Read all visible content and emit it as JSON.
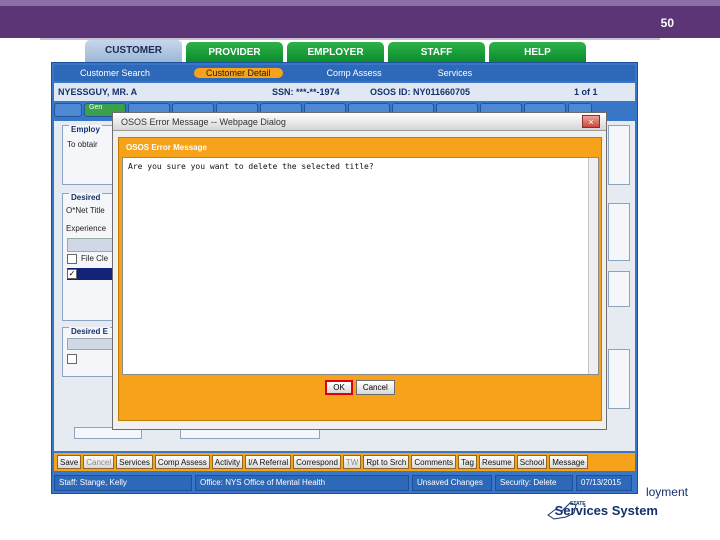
{
  "slide_number": "50",
  "top_tabs": [
    {
      "label": "CUSTOMER",
      "active": true
    },
    {
      "label": "PROVIDER",
      "active": false
    },
    {
      "label": "EMPLOYER",
      "active": false
    },
    {
      "label": "STAFF",
      "active": false
    },
    {
      "label": "HELP",
      "active": false
    }
  ],
  "subnav": [
    "Customer Search",
    "Customer Detail",
    "Comp Assess",
    "Services"
  ],
  "customer": {
    "name": "NYESSGUY, MR. A",
    "ssn": "SSN: ***-**-1974",
    "osos_id": "OSOS ID: NY011660705",
    "pagination": "1 of 1"
  },
  "left_fragments": {
    "employment_title": "Employ",
    "employment_text": "To obtair",
    "desired_title": "Desired",
    "onet_label": "O*Net Title",
    "experience_label": "Experience",
    "file_clerk": "File Cle",
    "desired_e": "Desired E",
    "gen_tab": "Gen"
  },
  "dialog": {
    "title": "OSOS Error Message -- Webpage Dialog",
    "close_glyph": "×",
    "header": "OSOS Error Message",
    "message": "Are you sure you want to delete the selected title?",
    "ok_label": "OK",
    "cancel_label": "Cancel"
  },
  "bottom_buttons": [
    {
      "label": "Save",
      "dim": false
    },
    {
      "label": "Cancel",
      "dim": true
    },
    {
      "label": "Services",
      "dim": false
    },
    {
      "label": "Comp Assess",
      "dim": false
    },
    {
      "label": "Activity",
      "dim": false
    },
    {
      "label": "I/A Referral",
      "dim": false
    },
    {
      "label": "Correspond",
      "dim": false
    },
    {
      "label": "TW",
      "dim": true
    },
    {
      "label": "Rpt to Srch",
      "dim": false
    },
    {
      "label": "Comments",
      "dim": false
    },
    {
      "label": "Tag",
      "dim": false
    },
    {
      "label": "Resume",
      "dim": false
    },
    {
      "label": "School",
      "dim": false
    },
    {
      "label": "Message",
      "dim": false
    }
  ],
  "status": {
    "staff": "Staff: Stange, Kelly",
    "office": "Office: NYS Office of Mental Health",
    "unsaved": "Unsaved Changes",
    "security": "Security: Delete",
    "date": "07/13/2015"
  },
  "logo": {
    "line1": "loyment",
    "line2": "Services System",
    "state": "STATE"
  },
  "colors": {
    "header_purple": "#5b3576",
    "tab_green": "#0a8c2c",
    "frame_blue": "#3a76c7",
    "accent_orange": "#f6a21a",
    "ok_highlight": "#e0000c"
  }
}
